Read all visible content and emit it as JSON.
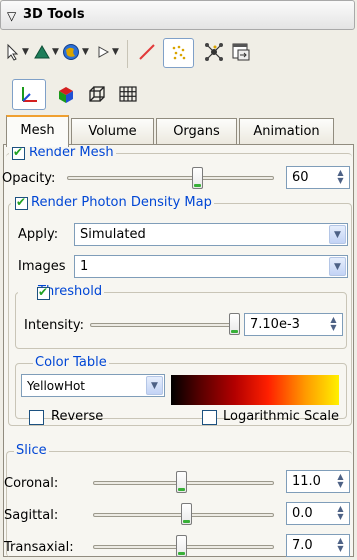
{
  "window": {
    "title": "3D Tools"
  },
  "tabs": [
    {
      "label": "Mesh"
    },
    {
      "label": "Volume"
    },
    {
      "label": "Organs"
    },
    {
      "label": "Animation"
    }
  ],
  "mesh": {
    "render_label": "Render Mesh",
    "opacity_label": "Opacity:",
    "opacity_value": "60",
    "opacity_level": 0.6
  },
  "photon": {
    "render_label": "Render Photon Density Map",
    "apply_label": "Apply:",
    "apply_value": "Simulated",
    "images_label": "Images",
    "images_value": "1",
    "threshold_label": "Threshold",
    "intensity_label": "Intensity:",
    "intensity_value": "7.10e-3",
    "color_table_label": "Color Table",
    "color_table_value": "YellowHot",
    "reverse_label": "Reverse",
    "log_label": "Logarithmic Scale"
  },
  "slice": {
    "label": "Slice",
    "coronal_label": "Coronal:",
    "coronal_value": "11.0",
    "sagittal_label": "Sagittal:",
    "sagittal_value": "0.0",
    "transaxial_label": "Transaxial:",
    "transaxial_value": "7.0"
  },
  "colors": {
    "accent_tab": "#f0a030",
    "group_label": "#0046d5",
    "check": "#21a121",
    "slider_mark": "#38b038"
  }
}
